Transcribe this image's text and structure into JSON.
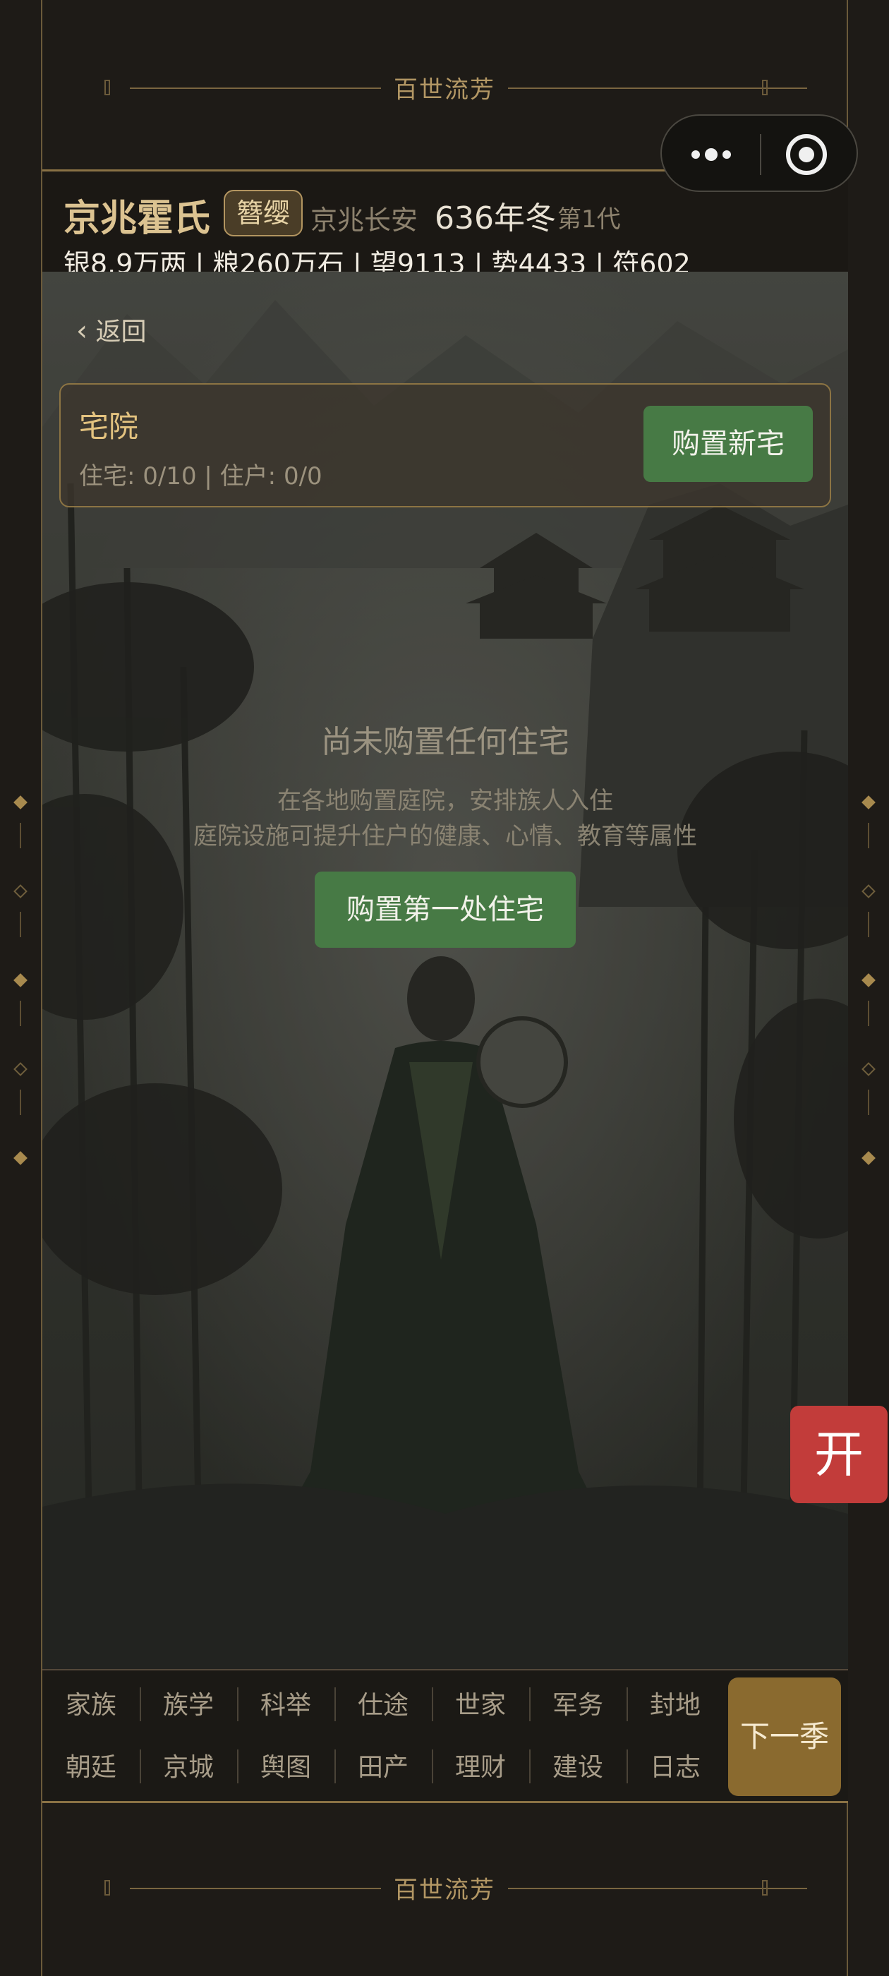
{
  "banner": {
    "title": "百世流芳"
  },
  "header": {
    "family_name": "京兆霍氏",
    "rank_badge": "簪缨",
    "location": "京兆长安",
    "year": "636年冬",
    "generation": "第1代",
    "stats": "银8.9万两 | 粮260万石 | 望9113 | 势4433 | 符602"
  },
  "scene": {
    "back_label": "返回",
    "panel": {
      "title": "宅院",
      "subtitle": "住宅: 0/10 | 住户: 0/0",
      "buy_button": "购置新宅"
    },
    "empty": {
      "title": "尚未购置任何住宅",
      "desc_line1": "在各地购置庭院，安排族人入住",
      "desc_line2": "庭院设施可提升住户的健康、心情、教育等属性",
      "cta": "购置第一处住宅"
    }
  },
  "nav": {
    "row1": [
      "家族",
      "族学",
      "科举",
      "仕途",
      "世家",
      "军务",
      "封地"
    ],
    "row2": [
      "朝廷",
      "京城",
      "舆图",
      "田产",
      "理财",
      "建设",
      "日志"
    ],
    "next": "下一季"
  },
  "open_button": "开",
  "icons": {
    "more": "more-dots-icon",
    "target": "target-icon",
    "back": "chevron-left-icon"
  },
  "colors": {
    "gold": "#dcc391",
    "green_button": "#477a45",
    "red_button": "#c23c3a",
    "next_button": "#8a6a2f"
  }
}
